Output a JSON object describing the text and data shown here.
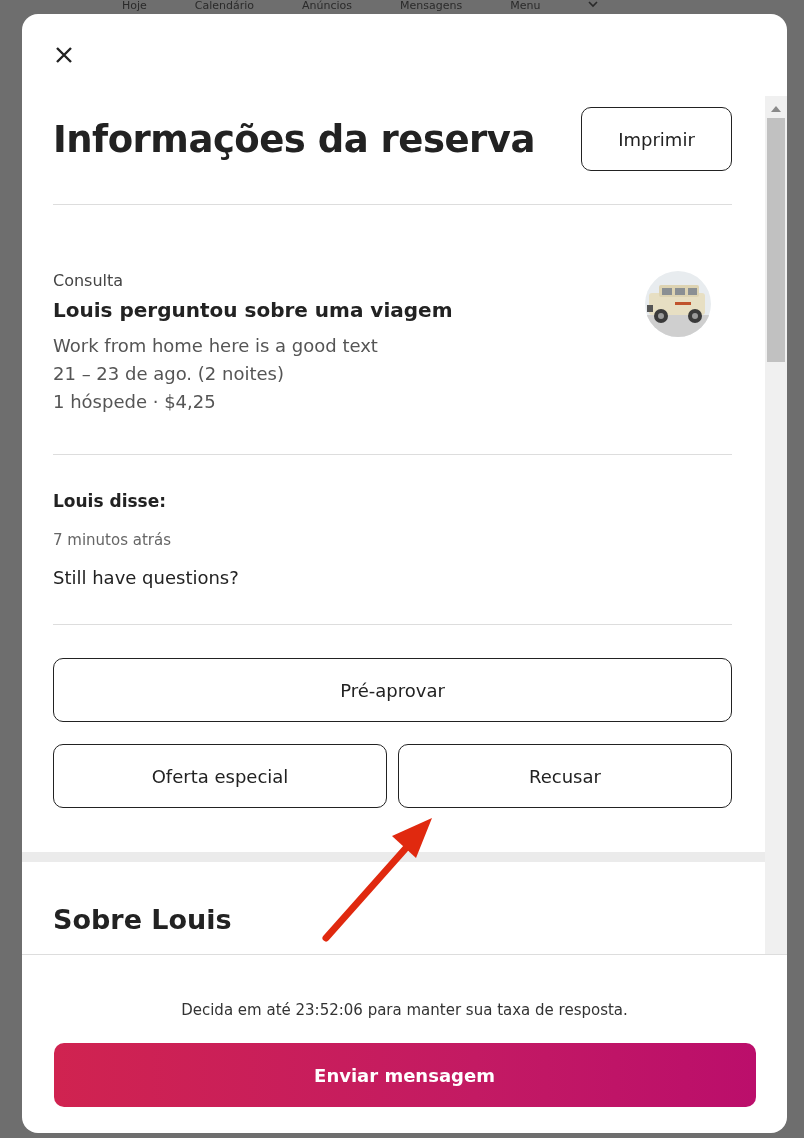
{
  "background_nav": {
    "items": [
      "Hoje",
      "Calendário",
      "Anúncios",
      "Mensagens",
      "Menu"
    ]
  },
  "modal": {
    "title": "Informações da reserva",
    "print_button": "Imprimir",
    "inquiry": {
      "label": "Consulta",
      "heading": "Louis perguntou sobre uma viagem",
      "details": [
        "Work from home here is a good text",
        "21 – 23 de ago. (2 noites)",
        "1 hóspede · $4,25"
      ]
    },
    "message": {
      "author": "Louis disse:",
      "time": "7 minutos atrás",
      "text": "Still have questions?"
    },
    "actions": [
      "Pré-aprovar",
      "Oferta especial",
      "Recusar"
    ],
    "about_heading": "Sobre Louis",
    "footer": {
      "note": "Decida em até 23:52:06 para manter sua taxa de resposta.",
      "send_button": "Enviar mensagem"
    }
  }
}
